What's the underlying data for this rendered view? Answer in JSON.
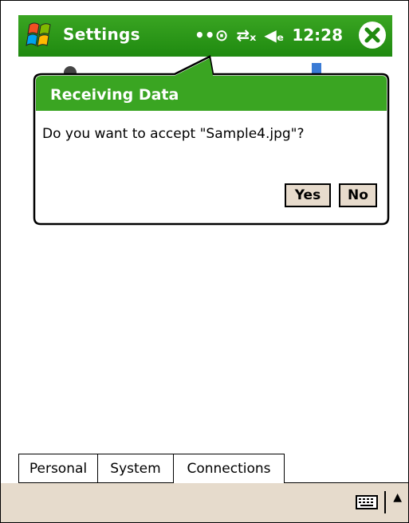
{
  "titlebar": {
    "title": "Settings",
    "time": "12:28"
  },
  "notification": {
    "title": "Receiving Data",
    "message": "Do you want to accept \"Sample4.jpg\"?",
    "yes_label": "Yes",
    "no_label": "No"
  },
  "tabs": [
    {
      "label": "Personal"
    },
    {
      "label": "System"
    },
    {
      "label": "Connections",
      "selected": true
    }
  ],
  "colors": {
    "titlebar": "#2a9a18",
    "bubble_header": "#3aa522",
    "button_bg": "#e7dbcc",
    "menubar_bg": "#e6dbcc"
  },
  "icons": [
    "windows-start-icon",
    "connectivity-icon",
    "network-icon",
    "volume-icon",
    "close-icon",
    "keyboard-icon",
    "up-arrow-icon"
  ]
}
